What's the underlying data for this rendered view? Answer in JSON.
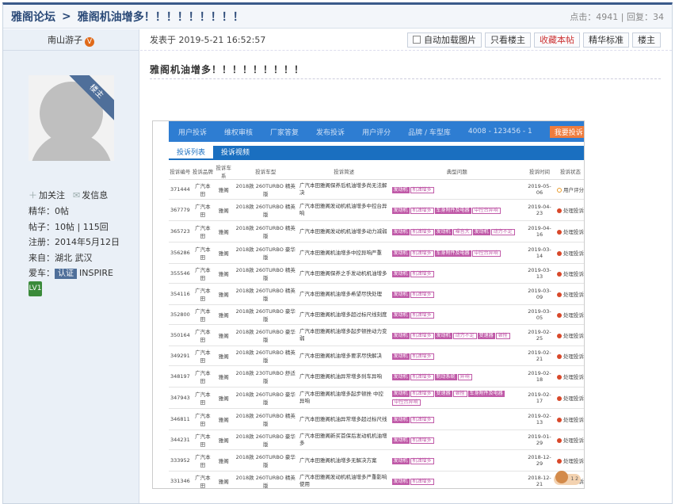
{
  "header": {
    "forum": "雅阁论坛",
    "separator": ">",
    "thread_title": "雅阁机油增多！！！！！！！！！",
    "stats": "点击：4941 | 回复：34"
  },
  "user": {
    "name": "南山游子",
    "v_badge": "V",
    "rank_ribbon": "楼主",
    "follow": "加关注",
    "message": "发信息",
    "stats": [
      "精华：0帖",
      "帖子：10帖 | 115回",
      "注册：2014年5月12日",
      "来自：湖北 武汉"
    ],
    "car_label": "爱车：",
    "car_tag": "认证",
    "car_model": "INSPIRE",
    "level": "LV1"
  },
  "post": {
    "date": "发表于 2019-5-21 16:52:57",
    "title": "雅阁机油增多！！！！！！！！！",
    "buttons": [
      "自动加载图片",
      "只看楼主",
      "收藏本帖",
      "精华标准",
      "楼主"
    ]
  },
  "screenshot": {
    "nav": [
      "用户投诉",
      "维权审核",
      "厂家答复",
      "发布投诉",
      "用户评分",
      "品牌 / 车型库",
      "4008 - 123456 - 1"
    ],
    "nav_button": "我要投诉",
    "tabs": [
      "投诉列表",
      "投诉视频"
    ],
    "columns": [
      "投诉编号",
      "投诉品牌",
      "投诉车系",
      "投诉车型",
      "投诉简述",
      "典型问题",
      "投诉时间",
      "投诉状态"
    ],
    "rows": [
      {
        "id": "371444",
        "brand": "广汽本田",
        "series": "雅阁",
        "model": "2018款 260TURBO 精英版",
        "desc": "广汽本田雅阁保养后机油增多尚无法解决",
        "tags": [
          [
            "发动机",
            0
          ],
          [
            "机油增多",
            1
          ]
        ],
        "date": "2019-05-06",
        "status": "用户评分",
        "st": "y"
      },
      {
        "id": "367779",
        "brand": "广汽本田",
        "series": "雅阁",
        "model": "2018款 260TURBO 精英版",
        "desc": "广汽本田雅阁发动机机油增多中控台异响",
        "tags": [
          [
            "发动机",
            0
          ],
          [
            "机油增多",
            1
          ],
          [
            "车身附件及电器",
            0
          ],
          [
            "中控台异响",
            1
          ]
        ],
        "date": "2019-04-23",
        "status": "处理投诉",
        "st": "r"
      },
      {
        "id": "365723",
        "brand": "广汽本田",
        "series": "雅阁",
        "model": "2018款 260TURBO 精英版",
        "desc": "广汽本田雅阁发动机机油增多动力减弱",
        "tags": [
          [
            "发动机",
            0
          ],
          [
            "机油增多",
            1
          ],
          [
            "发动机",
            0
          ],
          [
            "噪音大",
            1
          ],
          [
            "发动机",
            0
          ],
          [
            "动力不足",
            1
          ]
        ],
        "date": "2019-04-16",
        "status": "处理投诉",
        "st": "r"
      },
      {
        "id": "356286",
        "brand": "广汽本田",
        "series": "雅阁",
        "model": "2018款 260TURBO 豪华版",
        "desc": "广汽本田雅阁机油增多中控异响严重",
        "tags": [
          [
            "发动机",
            0
          ],
          [
            "机油增多",
            1
          ],
          [
            "车身附件及电器",
            0
          ],
          [
            "中控台异响",
            1
          ]
        ],
        "date": "2019-03-14",
        "status": "处理投诉",
        "st": "r"
      },
      {
        "id": "355546",
        "brand": "广汽本田",
        "series": "雅阁",
        "model": "2018款 260TURBO 精英版",
        "desc": "广汽本田雅阁保养之手发动机机油增多",
        "tags": [
          [
            "发动机",
            0
          ],
          [
            "机油增多",
            1
          ]
        ],
        "date": "2019-03-13",
        "status": "处理投诉",
        "st": "r"
      },
      {
        "id": "354116",
        "brand": "广汽本田",
        "series": "雅阁",
        "model": "2018款 260TURBO 精英版",
        "desc": "广汽本田雅阁机油增多希望尽快处理",
        "tags": [
          [
            "发动机",
            0
          ],
          [
            "机油增多",
            1
          ]
        ],
        "date": "2019-03-09",
        "status": "处理投诉",
        "st": "r"
      },
      {
        "id": "352800",
        "brand": "广汽本田",
        "series": "雅阁",
        "model": "2018款 260TURBO 豪华版",
        "desc": "广汽本田雅阁机油增多超过标尺线刻度",
        "tags": [
          [
            "发动机",
            0
          ],
          [
            "机油增多",
            1
          ]
        ],
        "date": "2019-03-05",
        "status": "处理投诉",
        "st": "r"
      },
      {
        "id": "350164",
        "brand": "广汽本田",
        "series": "雅阁",
        "model": "2018款 260TURBO 豪华版",
        "desc": "广汽本田雅阁机油增多起步顿挫动力变弱",
        "tags": [
          [
            "发动机",
            0
          ],
          [
            "机油增多",
            1
          ],
          [
            "发动机",
            0
          ],
          [
            "动力不足",
            1
          ],
          [
            "变速器",
            0
          ],
          [
            "顿挫",
            1
          ]
        ],
        "date": "2019-02-25",
        "status": "处理投诉",
        "st": "r"
      },
      {
        "id": "349291",
        "brand": "广汽本田",
        "series": "雅阁",
        "model": "2018款 260TURBO 精英版",
        "desc": "广汽本田雅阁机油增多要求尽快解决",
        "tags": [
          [
            "发动机",
            0
          ],
          [
            "机油增多",
            1
          ]
        ],
        "date": "2019-02-21",
        "status": "处理投诉",
        "st": "r"
      },
      {
        "id": "348197",
        "brand": "广汽本田",
        "series": "雅阁",
        "model": "2018款 230TURBO 舒适版",
        "desc": "广汽本田雅阁机油异常增多刹车异响",
        "tags": [
          [
            "发动机",
            0
          ],
          [
            "机油增多",
            1
          ],
          [
            "制动系统",
            0
          ],
          [
            "异响",
            1
          ]
        ],
        "date": "2019-02-18",
        "status": "处理投诉",
        "st": "r"
      },
      {
        "id": "347943",
        "brand": "广汽本田",
        "series": "雅阁",
        "model": "2018款 260TURBO 豪华版",
        "desc": "广汽本田雅阁机油增多起步顿挫 中控异响",
        "tags": [
          [
            "发动机",
            0
          ],
          [
            "机油增多",
            1
          ],
          [
            "变速器",
            0
          ],
          [
            "顿挫",
            1
          ],
          [
            "车身附件及电器",
            0
          ],
          [
            "中控台异响",
            1
          ]
        ],
        "date": "2019-02-17",
        "status": "处理投诉",
        "st": "r"
      },
      {
        "id": "346811",
        "brand": "广汽本田",
        "series": "雅阁",
        "model": "2018款 260TURBO 精英版",
        "desc": "广汽本田雅阁机油异常增多超过标尺线",
        "tags": [
          [
            "发动机",
            0
          ],
          [
            "机油增多",
            1
          ]
        ],
        "date": "2019-02-13",
        "status": "处理投诉",
        "st": "r"
      },
      {
        "id": "344231",
        "brand": "广汽本田",
        "series": "雅阁",
        "model": "2018款 260TURBO 豪华版",
        "desc": "广汽本田雅阁新买首保后发动机机油增多",
        "tags": [
          [
            "发动机",
            0
          ],
          [
            "机油增多",
            1
          ]
        ],
        "date": "2019-01-29",
        "status": "处理投诉",
        "st": "r"
      },
      {
        "id": "333952",
        "brand": "广汽本田",
        "series": "雅阁",
        "model": "2018款 260TURBO 豪华版",
        "desc": "广汽本田雅阁机油增多无解决方案",
        "tags": [
          [
            "发动机",
            0
          ],
          [
            "机油增多",
            1
          ]
        ],
        "date": "2018-12-29",
        "status": "处理投诉",
        "st": "r"
      },
      {
        "id": "331346",
        "brand": "广汽本田",
        "series": "雅阁",
        "model": "2018款 260TURBO 精英版",
        "desc": "广汽本田雅阁发动机机油增多严重影响使用",
        "tags": [
          [
            "发动机",
            0
          ],
          [
            "机油增多",
            1
          ]
        ],
        "date": "2018-12-21",
        "status": "处理投诉",
        "st": "r"
      }
    ]
  }
}
